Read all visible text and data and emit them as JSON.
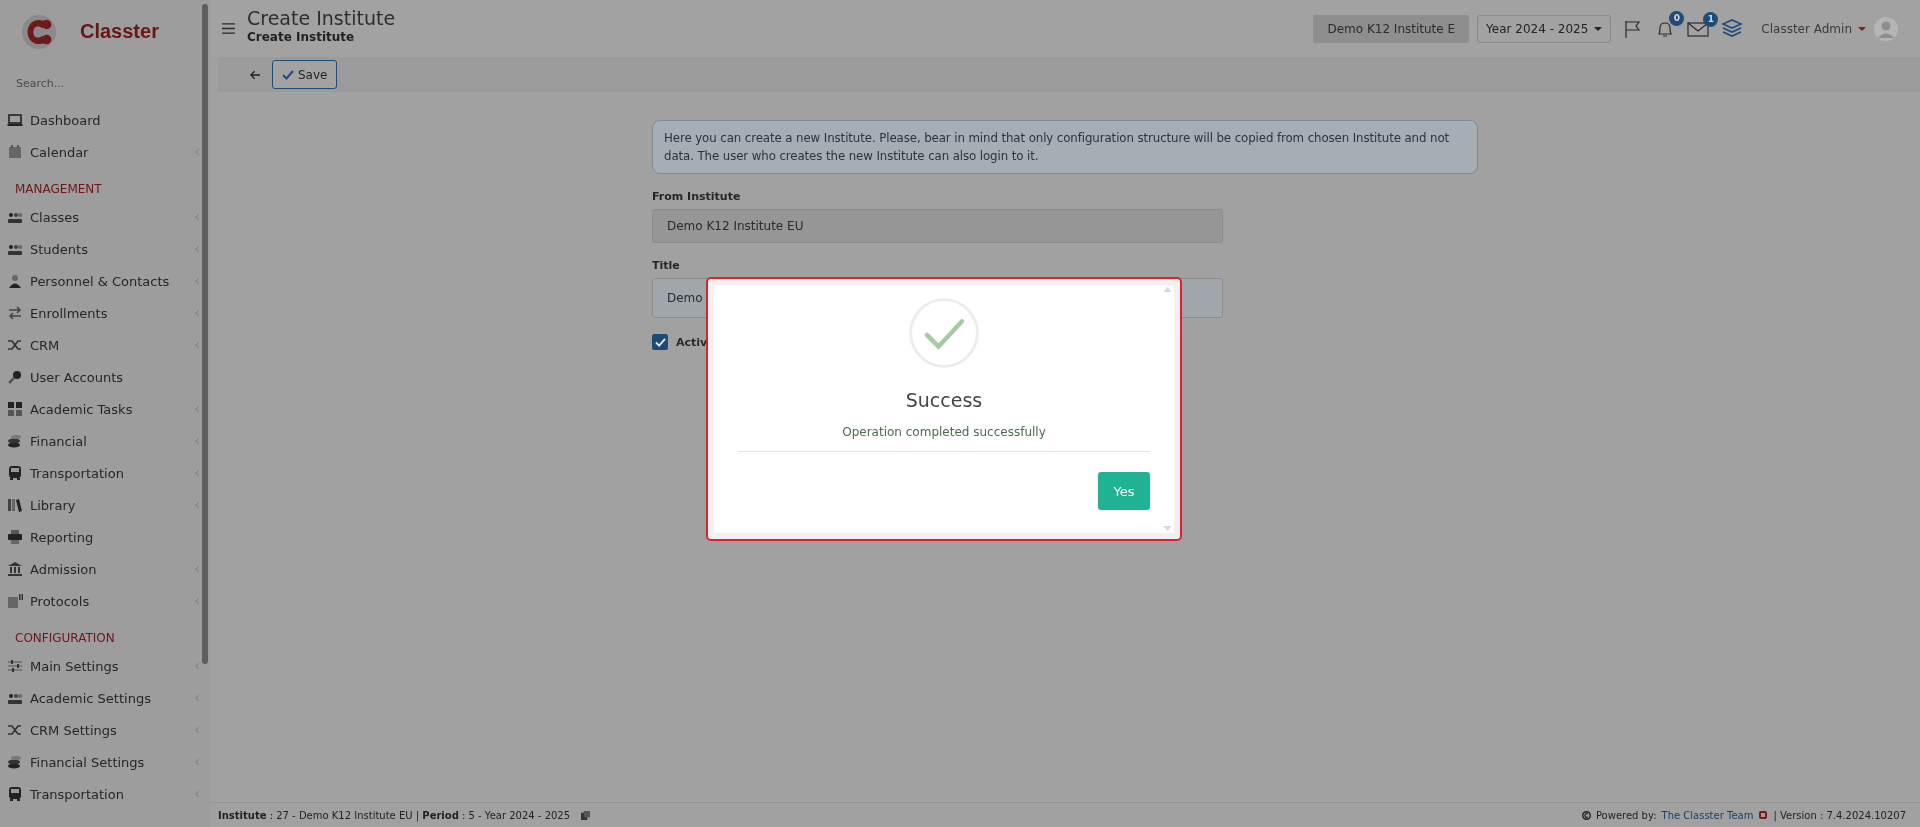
{
  "sidebar": {
    "brand": "Classter",
    "search": {
      "placeholder": "Search..."
    },
    "sections": [
      {
        "items": [
          {
            "label": "Dashboard",
            "expandable": false
          },
          {
            "label": "Calendar",
            "expandable": true
          }
        ]
      },
      {
        "heading": "MANAGEMENT",
        "items": [
          {
            "label": "Classes",
            "expandable": true
          },
          {
            "label": "Students",
            "expandable": true
          },
          {
            "label": "Personnel & Contacts",
            "expandable": true
          },
          {
            "label": "Enrollments",
            "expandable": true
          },
          {
            "label": "CRM",
            "expandable": true
          },
          {
            "label": "User Accounts",
            "expandable": false
          },
          {
            "label": "Academic Tasks",
            "expandable": true
          },
          {
            "label": "Financial",
            "expandable": true
          },
          {
            "label": "Transportation",
            "expandable": true
          },
          {
            "label": "Library",
            "expandable": true
          },
          {
            "label": "Reporting",
            "expandable": false
          },
          {
            "label": "Admission",
            "expandable": true
          },
          {
            "label": "Protocols",
            "expandable": true
          }
        ]
      },
      {
        "heading": "CONFIGURATION",
        "items": [
          {
            "label": "Main Settings",
            "expandable": true
          },
          {
            "label": "Academic Settings",
            "expandable": true
          },
          {
            "label": "CRM Settings",
            "expandable": true
          },
          {
            "label": "Financial Settings",
            "expandable": true
          },
          {
            "label": "Transportation",
            "expandable": true
          }
        ]
      }
    ]
  },
  "header": {
    "title": "Create Institute",
    "subtitle": "Create Institute",
    "institute": "Demo K12 Institute E",
    "year": "Year 2024 - 2025",
    "notifications": "0",
    "messages": "1",
    "user": "Classter Admin"
  },
  "toolbar": {
    "save": "Save"
  },
  "form": {
    "info": "Here you can create a new Institute. Please, bear in mind that only configuration structure will be copied from chosen Institute and not data. The user who creates the new Institute can also login to it.",
    "from_label": "From Institute",
    "from_value": "Demo K12 Institute EU",
    "title_label": "Title",
    "title_value": "Demo",
    "active": {
      "label": "Activ",
      "checked": true
    }
  },
  "dialog": {
    "title": "Success",
    "message": "Operation completed successfully",
    "button": "Yes"
  },
  "footer": {
    "context": "**Institute** : 27 - Demo K12 Institute EU | **Period** : 5 - Year 2024 - 2025",
    "powered_by": "Powered by:",
    "team": "The Classter Team",
    "version": "| Version : 7.4.2024.10207"
  }
}
